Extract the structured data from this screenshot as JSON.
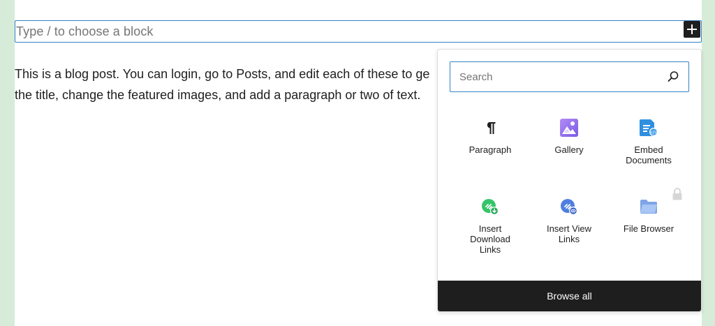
{
  "editor": {
    "block_placeholder": "Type / to choose a block",
    "add_block_label": "+",
    "paragraph_lines": [
      "This is a blog post. You can login, go to Posts, and edit each of these to ge",
      "the title, change the featured images, and add a paragraph or two of text."
    ]
  },
  "inserter": {
    "search_placeholder": "Search",
    "blocks": [
      {
        "label": "Paragraph",
        "icon": "pilcrow-icon"
      },
      {
        "label": "Gallery",
        "icon": "gallery-icon"
      },
      {
        "label": "Embed\nDocuments",
        "icon": "embed-documents-icon"
      },
      {
        "label": "Insert\nDownload\nLinks",
        "icon": "download-link-icon"
      },
      {
        "label": "Insert View\nLinks",
        "icon": "view-link-icon"
      },
      {
        "label": "File Browser",
        "icon": "folder-icon"
      }
    ],
    "browse_all_label": "Browse all"
  },
  "colors": {
    "accent_blue": "#3582c4",
    "page_background": "#d7ebd9",
    "dark": "#1e1e1e"
  }
}
